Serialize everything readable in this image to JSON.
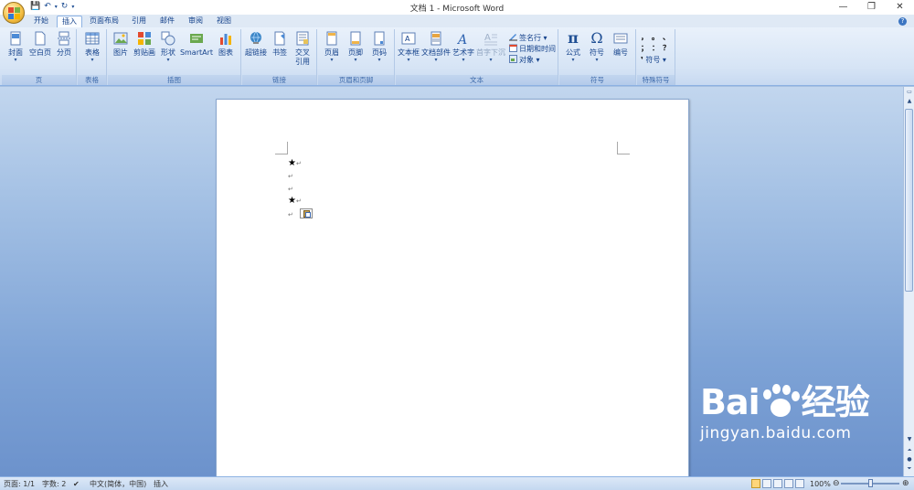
{
  "window": {
    "title": "文档 1 - Microsoft Word",
    "controls": [
      "minimize",
      "restore",
      "close"
    ]
  },
  "quick_access": {
    "items": [
      "save-icon",
      "undo-icon",
      "redo-icon",
      "customize-icon"
    ]
  },
  "tabs": [
    {
      "label": "开始",
      "active": false
    },
    {
      "label": "插入",
      "active": true
    },
    {
      "label": "页面布局",
      "active": false
    },
    {
      "label": "引用",
      "active": false
    },
    {
      "label": "邮件",
      "active": false
    },
    {
      "label": "审阅",
      "active": false
    },
    {
      "label": "视图",
      "active": false
    }
  ],
  "ribbon": {
    "groups": [
      {
        "label": "页",
        "buttons": [
          "封面",
          "空白页",
          "分页"
        ]
      },
      {
        "label": "表格",
        "buttons": [
          "表格"
        ]
      },
      {
        "label": "插图",
        "buttons": [
          "图片",
          "剪贴画",
          "形状",
          "SmartArt",
          "图表"
        ]
      },
      {
        "label": "链接",
        "buttons": [
          "超链接",
          "书签",
          "交叉",
          "引用"
        ]
      },
      {
        "label": "页眉和页脚",
        "buttons": [
          "页眉",
          "页脚",
          "页码"
        ]
      },
      {
        "label": "文本",
        "buttons": [
          "文本框",
          "文档部件",
          "艺术字",
          "首字下沉"
        ],
        "small": [
          "签名行",
          "日期和时间",
          "对象"
        ]
      },
      {
        "label": "符号",
        "buttons": [
          "公式",
          "符号",
          "编号"
        ]
      },
      {
        "label": "特殊符号",
        "chars": [
          "，",
          "。",
          "、",
          "；",
          "：",
          "？"
        ],
        "symbol_label": "符号"
      }
    ]
  },
  "document": {
    "lines": [
      {
        "text": "★",
        "mark": "↵"
      },
      {
        "text": "",
        "mark": "↵"
      },
      {
        "text": "",
        "mark": "↵"
      },
      {
        "text": "★",
        "mark": "↵"
      },
      {
        "text": "",
        "mark": "↵"
      }
    ]
  },
  "watermark": {
    "brand": "Bai",
    "brand_suffix": "经验",
    "site": "jingyan.baidu.com"
  },
  "status": {
    "page": "页面: 1/1",
    "words": "字数: 2",
    "language": "中文(简体，中国)",
    "mode": "插入",
    "zoom": "100%"
  }
}
